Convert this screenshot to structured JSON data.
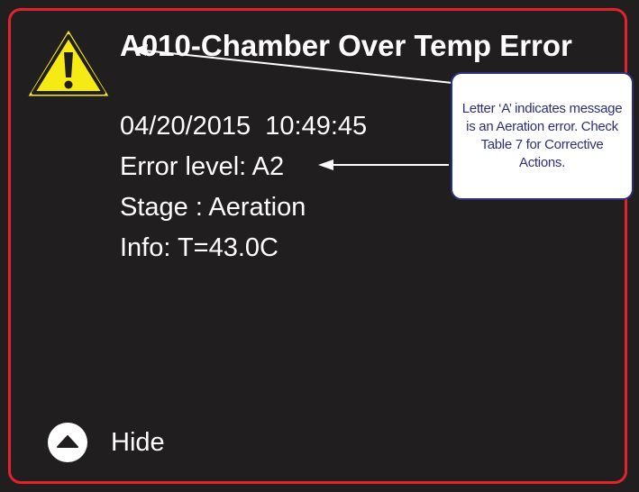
{
  "error_screen": {
    "title": "A010-Chamber Over Temp Error",
    "timestamp": "04/20/2015  10:49:45",
    "error_level": "Error level: A2",
    "stage": "Stage : Aeration",
    "info": "Info: T=43.0C",
    "warning_icon": "warning-triangle-icon",
    "hide_button": {
      "icon": "chevron-up-circle-icon",
      "label": "Hide"
    }
  },
  "annotation": {
    "callout_text": "Letter ‘A’ indicates message is an Aeration error. Check Table 7 for Corrective Actions."
  },
  "colors": {
    "screen_background": "#211e1f",
    "frame_border": "#e2232c",
    "warning_fill": "#f6ea14",
    "text": "#ffffff",
    "callout_text": "#2d2f7e",
    "callout_border": "#2d2f7e"
  }
}
